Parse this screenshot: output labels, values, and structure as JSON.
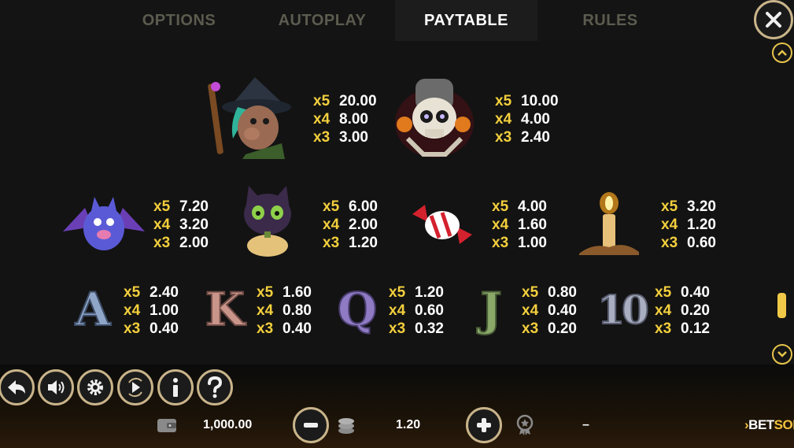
{
  "tabs": [
    {
      "label": "OPTIONS",
      "active": false
    },
    {
      "label": "AUTOPLAY",
      "active": false
    },
    {
      "label": "PAYTABLE",
      "active": true
    },
    {
      "label": "RULES",
      "active": false
    }
  ],
  "paytable": {
    "witch": {
      "rows": [
        {
          "mult": "x5",
          "val": "20.00"
        },
        {
          "mult": "x4",
          "val": "8.00"
        },
        {
          "mult": "x3",
          "val": "3.00"
        }
      ]
    },
    "skull": {
      "rows": [
        {
          "mult": "x5",
          "val": "10.00"
        },
        {
          "mult": "x4",
          "val": "4.00"
        },
        {
          "mult": "x3",
          "val": "2.40"
        }
      ]
    },
    "bat": {
      "rows": [
        {
          "mult": "x5",
          "val": "7.20"
        },
        {
          "mult": "x4",
          "val": "3.20"
        },
        {
          "mult": "x3",
          "val": "2.00"
        }
      ]
    },
    "cat": {
      "rows": [
        {
          "mult": "x5",
          "val": "6.00"
        },
        {
          "mult": "x4",
          "val": "2.00"
        },
        {
          "mult": "x3",
          "val": "1.20"
        }
      ]
    },
    "candy": {
      "rows": [
        {
          "mult": "x5",
          "val": "4.00"
        },
        {
          "mult": "x4",
          "val": "1.60"
        },
        {
          "mult": "x3",
          "val": "1.00"
        }
      ]
    },
    "candle": {
      "rows": [
        {
          "mult": "x5",
          "val": "3.20"
        },
        {
          "mult": "x4",
          "val": "1.20"
        },
        {
          "mult": "x3",
          "val": "0.60"
        }
      ]
    },
    "A": {
      "letter": "A",
      "rows": [
        {
          "mult": "x5",
          "val": "2.40"
        },
        {
          "mult": "x4",
          "val": "1.00"
        },
        {
          "mult": "x3",
          "val": "0.40"
        }
      ]
    },
    "K": {
      "letter": "K",
      "rows": [
        {
          "mult": "x5",
          "val": "1.60"
        },
        {
          "mult": "x4",
          "val": "0.80"
        },
        {
          "mult": "x3",
          "val": "0.40"
        }
      ]
    },
    "Q": {
      "letter": "Q",
      "rows": [
        {
          "mult": "x5",
          "val": "1.20"
        },
        {
          "mult": "x4",
          "val": "0.60"
        },
        {
          "mult": "x3",
          "val": "0.32"
        }
      ]
    },
    "J": {
      "letter": "J",
      "rows": [
        {
          "mult": "x5",
          "val": "0.80"
        },
        {
          "mult": "x4",
          "val": "0.40"
        },
        {
          "mult": "x3",
          "val": "0.20"
        }
      ]
    },
    "10": {
      "letter": "10",
      "rows": [
        {
          "mult": "x5",
          "val": "0.40"
        },
        {
          "mult": "x4",
          "val": "0.20"
        },
        {
          "mult": "x3",
          "val": "0.12"
        }
      ]
    }
  },
  "bottom": {
    "balance": "1,000.00",
    "bet": "1.20",
    "win": "–",
    "logo_a": "BET",
    "logo_b": "SOFT"
  },
  "colors": {
    "accent_gold": "#f3cf3d",
    "button_ring": "#c9b48a",
    "inactive_tab": "#5b5b4f"
  },
  "icons": [
    "close-icon",
    "back-icon",
    "sound-icon",
    "gear-icon",
    "autoplay-icon",
    "info-icon",
    "help-icon",
    "wallet-icon",
    "minus-icon",
    "coins-icon",
    "plus-icon",
    "award-icon",
    "chevron-up-icon",
    "chevron-down-icon"
  ]
}
